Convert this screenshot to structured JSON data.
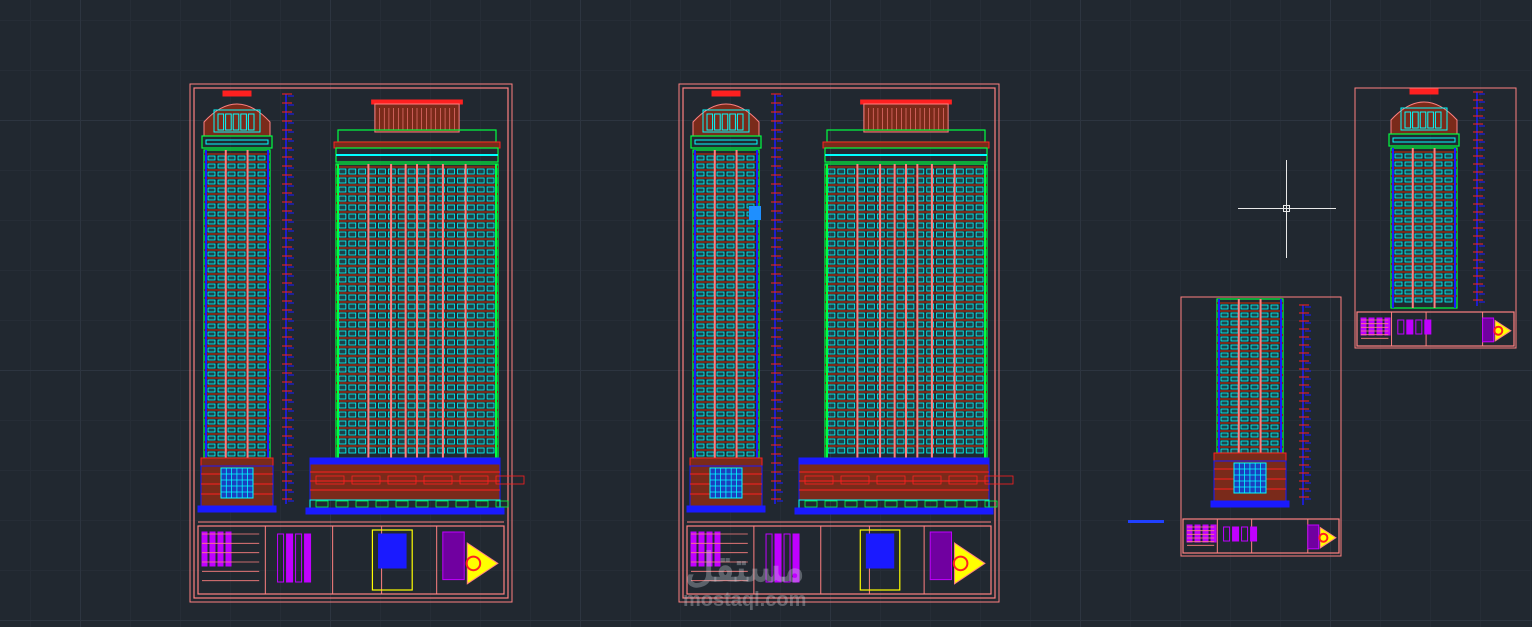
{
  "app": {
    "canvas_background": "#212830",
    "watermark": {
      "glyph": "مستقل",
      "domain": "mostaql.com"
    }
  },
  "colors": {
    "border": "#ff8080",
    "cyan": "#00ffff",
    "green": "#00ff40",
    "red": "#ff2020",
    "blue": "#1a1aff",
    "brown": "#7a2a1a",
    "yellow": "#ffff00",
    "magenta": "#c000ff",
    "white": "#ffffff",
    "grip": "#1e8fff"
  },
  "cursor": {
    "type": "crosshair",
    "pickbox": true
  },
  "sheets": [
    {
      "name": "sheet-1",
      "towers": [
        "slim",
        "wide"
      ],
      "title_block": "full"
    },
    {
      "name": "sheet-2",
      "towers": [
        "slim",
        "wide"
      ],
      "title_block": "full"
    },
    {
      "name": "sheet-3",
      "towers": [
        "slim-lower"
      ],
      "title_block": "small"
    },
    {
      "name": "sheet-4",
      "towers": [
        "slim-upper"
      ],
      "title_block": "small"
    }
  ]
}
